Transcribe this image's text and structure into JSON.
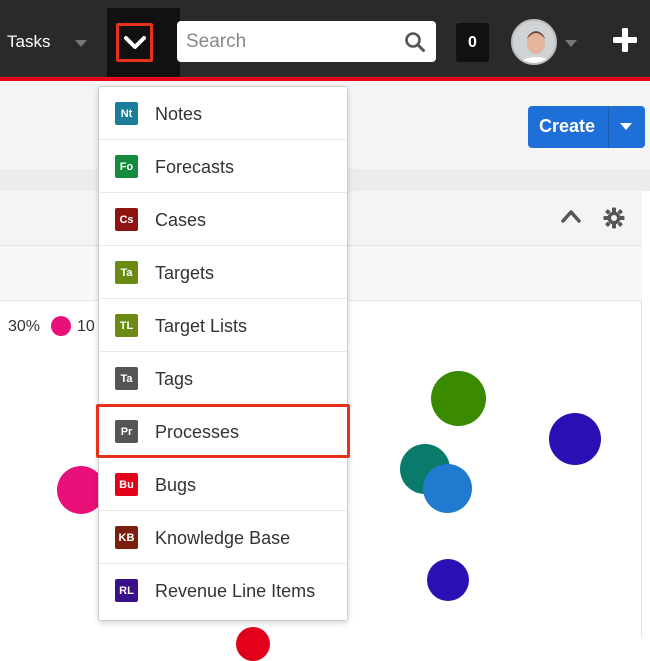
{
  "header": {
    "tasks_label": "Tasks",
    "search_placeholder": "Search",
    "notifications_count": "0",
    "accent_color": "#e2001a"
  },
  "toolbar": {
    "create_label": "Create"
  },
  "dashlet": {
    "legend_partial_1": "30%",
    "legend_partial_2": "10",
    "colors": {
      "pink": "#e8117a",
      "green": "#3a8a00",
      "navy": "#2b0fb5",
      "teal": "#0a7a6a",
      "blue": "#1f7ad0",
      "red": "#e2001a"
    }
  },
  "menu": {
    "items": [
      {
        "badge": "Nt",
        "label": "Notes",
        "color": "#1a7d9c"
      },
      {
        "badge": "Fo",
        "label": "Forecasts",
        "color": "#138a3e"
      },
      {
        "badge": "Cs",
        "label": "Cases",
        "color": "#8e1414"
      },
      {
        "badge": "Ta",
        "label": "Targets",
        "color": "#6b8a14"
      },
      {
        "badge": "TL",
        "label": "Target Lists",
        "color": "#6b8a14"
      },
      {
        "badge": "Ta",
        "label": "Tags",
        "color": "#555555"
      },
      {
        "badge": "Pr",
        "label": "Processes",
        "color": "#555555"
      },
      {
        "badge": "Bu",
        "label": "Bugs",
        "color": "#e2001a"
      },
      {
        "badge": "KB",
        "label": "Knowledge Base",
        "color": "#7a1f0e"
      },
      {
        "badge": "RL",
        "label": "Revenue Line Items",
        "color": "#3a0f8a"
      }
    ],
    "highlighted": "Processes"
  }
}
